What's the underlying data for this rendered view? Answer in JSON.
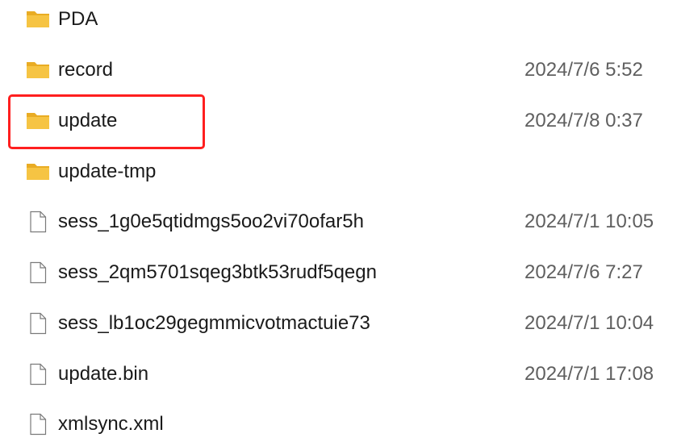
{
  "files": [
    {
      "name": "PDA",
      "type": "folder",
      "date": "",
      "icon": "folder-icon"
    },
    {
      "name": "record",
      "type": "folder",
      "date": "2024/7/6 5:52",
      "icon": "folder-icon"
    },
    {
      "name": "update",
      "type": "folder",
      "date": "2024/7/8 0:37",
      "icon": "folder-icon"
    },
    {
      "name": "update-tmp",
      "type": "folder",
      "date": "",
      "icon": "folder-icon"
    },
    {
      "name": "sess_1g0e5qtidmgs5oo2vi70ofar5h",
      "type": "file",
      "date": "2024/7/1 10:05",
      "icon": "file-icon"
    },
    {
      "name": "sess_2qm5701sqeg3btk53rudf5qegn",
      "type": "file",
      "date": "2024/7/6 7:27",
      "icon": "file-icon"
    },
    {
      "name": "sess_lb1oc29gegmmicvotmactuie73",
      "type": "file",
      "date": "2024/7/1 10:04",
      "icon": "file-icon"
    },
    {
      "name": "update.bin",
      "type": "file",
      "date": "2024/7/1 17:08",
      "icon": "file-icon"
    },
    {
      "name": "xmlsync.xml",
      "type": "file",
      "date": "",
      "icon": "file-icon"
    }
  ],
  "highlight": {
    "target": "update",
    "color": "#ff1f1f"
  },
  "colors": {
    "folder": "#f6c443",
    "folder_back": "#e9ac24",
    "file_stroke": "#7a7a7a",
    "date_text": "#5f5f5f"
  }
}
